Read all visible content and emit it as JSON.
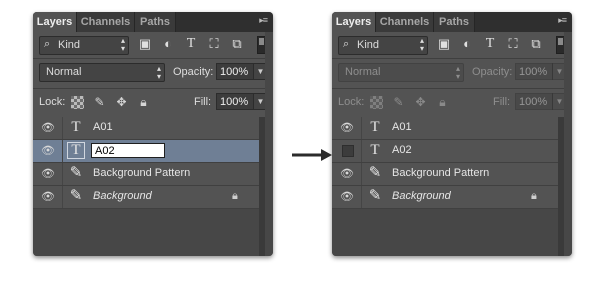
{
  "panels": [
    {
      "tabs": [
        "Layers",
        "Channels",
        "Paths"
      ],
      "filter_kind": "Kind",
      "blend_mode": "Normal",
      "opacity_label": "Opacity:",
      "opacity_value": "100%",
      "lock_label": "Lock:",
      "fill_label": "Fill:",
      "fill_value": "100%",
      "layers": [
        {
          "name": "A01",
          "visible": true,
          "icon": "type-icon"
        },
        {
          "name": "A02",
          "visible": true,
          "icon": "type-icon",
          "selected": true,
          "editing": true
        },
        {
          "name": "Background Pattern",
          "visible": true,
          "icon": "brush-icon"
        },
        {
          "name": "Background",
          "visible": true,
          "icon": "brush-icon",
          "italic": true,
          "locked": true
        }
      ]
    },
    {
      "tabs": [
        "Layers",
        "Channels",
        "Paths"
      ],
      "filter_kind": "Kind",
      "blend_mode": "Normal",
      "opacity_label": "Opacity:",
      "opacity_value": "100%",
      "lock_label": "Lock:",
      "fill_label": "Fill:",
      "fill_value": "100%",
      "layers": [
        {
          "name": "A01",
          "visible": true,
          "icon": "type-icon"
        },
        {
          "name": "A02",
          "visible": false,
          "icon": "type-icon"
        },
        {
          "name": "Background Pattern",
          "visible": true,
          "icon": "brush-icon"
        },
        {
          "name": "Background",
          "visible": true,
          "icon": "brush-icon",
          "italic": true,
          "locked": true
        }
      ]
    }
  ],
  "colors": {
    "panel_bg": "#535353",
    "selected_row": "#6f7f95",
    "tab_bar": "#2f2f2f"
  }
}
